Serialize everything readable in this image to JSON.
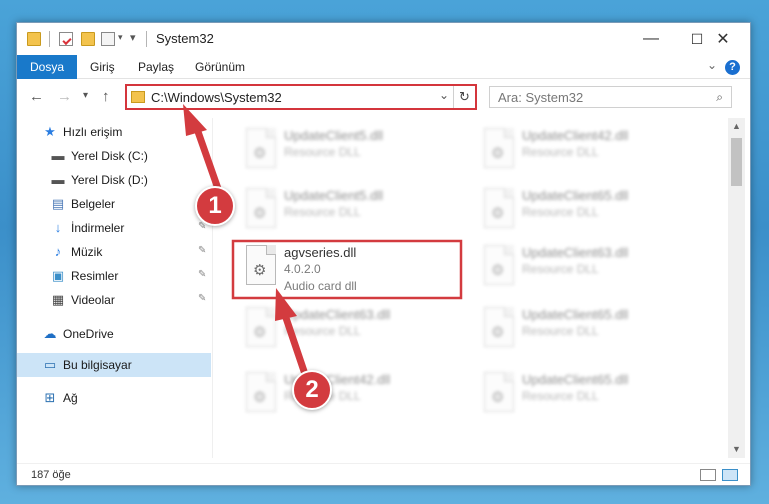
{
  "window": {
    "title": "System32",
    "controls": {
      "minimize": "—",
      "maximize": "☐",
      "close": "✕"
    }
  },
  "ribbon": {
    "tabs": [
      {
        "label": "Dosya",
        "active": true
      },
      {
        "label": "Giriş"
      },
      {
        "label": "Paylaş"
      },
      {
        "label": "Görünüm"
      }
    ],
    "help_label": "?"
  },
  "nav": {
    "address_path": "C:\\Windows\\System32",
    "search_placeholder": "Ara: System32"
  },
  "sidebar": {
    "items": [
      {
        "label": "Hızlı erişim",
        "icon": "star-icon"
      },
      {
        "label": "Yerel Disk (C:)",
        "icon": "drive-icon",
        "pinned": true
      },
      {
        "label": "Yerel Disk (D:)",
        "icon": "drive-icon",
        "pinned": true
      },
      {
        "label": "Belgeler",
        "icon": "document-icon",
        "pinned": true
      },
      {
        "label": "İndirmeler",
        "icon": "download-icon",
        "pinned": true
      },
      {
        "label": "Müzik",
        "icon": "music-icon",
        "pinned": true
      },
      {
        "label": "Resimler",
        "icon": "picture-icon",
        "pinned": true
      },
      {
        "label": "Videolar",
        "icon": "video-icon",
        "pinned": true
      },
      {
        "label": "OneDrive",
        "icon": "cloud-icon"
      },
      {
        "label": "Bu bilgisayar",
        "icon": "computer-icon",
        "selected": true
      },
      {
        "label": "Ağ",
        "icon": "network-icon"
      }
    ]
  },
  "files": [
    {
      "name": "UpdateClient5.dll",
      "sub": "Resource DLL"
    },
    {
      "name": "UpdateClient42.dll",
      "sub": "Resource DLL"
    },
    {
      "name": "UpdateClient5.dll",
      "sub": "Resource DLL"
    },
    {
      "name": "UpdateClient65.dll",
      "sub": "Resource DLL"
    },
    {
      "name": "agvseries.dll",
      "sub": "4.0.2.0",
      "sub2": "Audio card dll",
      "highlighted": true
    },
    {
      "name": "UpdateClient63.dll",
      "sub": "Resource DLL"
    },
    {
      "name": "UpdateClient63.dll",
      "sub": "Resource DLL"
    },
    {
      "name": "UpdateClient65.dll",
      "sub": "Resource DLL"
    },
    {
      "name": "UpdateClient42.dll",
      "sub": "Resource DLL"
    },
    {
      "name": "UpdateClient65.dll",
      "sub": "Resource DLL"
    }
  ],
  "status": {
    "item_count": "187 öğe"
  },
  "annotations": {
    "step1": "1",
    "step2": "2",
    "color": "#d33b3f"
  }
}
